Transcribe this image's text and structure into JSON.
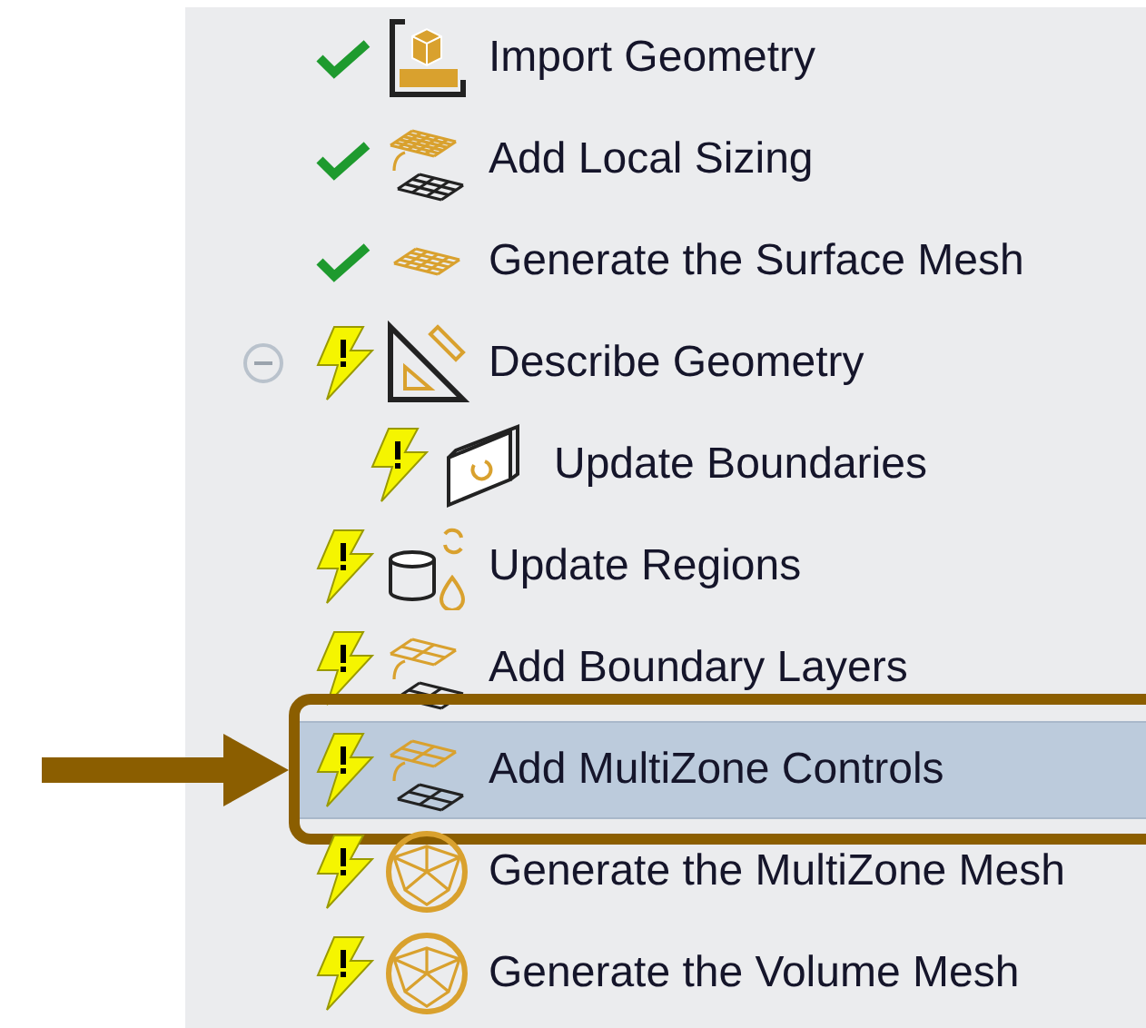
{
  "workflow": [
    {
      "label": "Import Geometry",
      "complete": true,
      "kind": "cad",
      "selected": false
    },
    {
      "label": "Add Local Sizing",
      "complete": true,
      "kind": "sizing",
      "selected": false
    },
    {
      "label": "Generate the Surface Mesh",
      "complete": true,
      "kind": "surface",
      "selected": false
    },
    {
      "label": "Describe Geometry",
      "complete": false,
      "kind": "geometry",
      "selected": false,
      "expanded": true,
      "children": [
        {
          "label": "Update Boundaries",
          "complete": false,
          "kind": "boundaries",
          "selected": false
        }
      ]
    },
    {
      "label": "Update Regions",
      "complete": false,
      "kind": "regions",
      "selected": false
    },
    {
      "label": "Add Boundary Layers",
      "complete": false,
      "kind": "layers",
      "selected": false
    },
    {
      "label": "Add MultiZone Controls",
      "complete": false,
      "kind": "layers",
      "selected": true,
      "callout": true
    },
    {
      "label": "Generate the MultiZone Mesh",
      "complete": false,
      "kind": "sphere",
      "selected": false
    },
    {
      "label": "Generate the Volume Mesh",
      "complete": false,
      "kind": "sphere",
      "selected": false
    }
  ]
}
